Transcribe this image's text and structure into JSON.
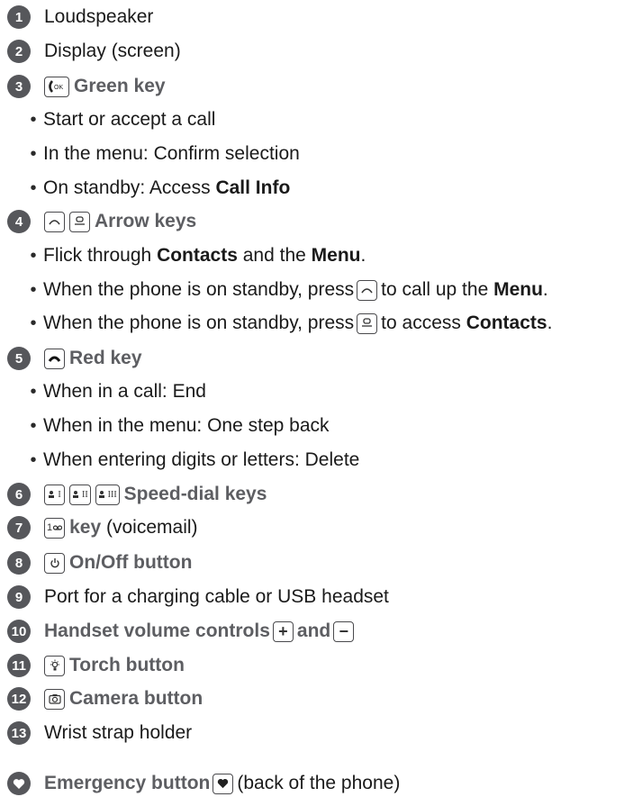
{
  "items": [
    {
      "num": "1",
      "label": "Loudspeaker"
    },
    {
      "num": "2",
      "label": "Display (screen)"
    },
    {
      "num": "3",
      "label": "Green key",
      "key_text": "OK",
      "bullets": [
        {
          "text": "Start or accept a call"
        },
        {
          "text": "In the menu: Confirm selection"
        },
        {
          "pre": "On standby: Access ",
          "bold": "Call Info"
        }
      ]
    },
    {
      "num": "4",
      "label": "Arrow keys",
      "bullets": [
        {
          "pre": "Flick through ",
          "bold1": "Contacts",
          "mid": " and the ",
          "bold2": "Menu",
          "post": "."
        },
        {
          "pre": "When the phone is on standby, press",
          "post": "to call up the ",
          "bold": "Menu",
          "end": "."
        },
        {
          "pre": "When the phone is on standby, press",
          "post": "to access ",
          "bold": "Contacts",
          "end": "."
        }
      ]
    },
    {
      "num": "5",
      "label": "Red key",
      "bullets": [
        {
          "text": "When in a call: End"
        },
        {
          "text": "When in the menu: One step back"
        },
        {
          "text": "When entering digits or letters: Delete"
        }
      ]
    },
    {
      "num": "6",
      "label": "Speed-dial keys",
      "keys": [
        "I",
        "II",
        "III"
      ]
    },
    {
      "num": "7",
      "key_text": "1",
      "label_bold": "key",
      "label_rest": " (voicemail)"
    },
    {
      "num": "8",
      "label": "On/Off button"
    },
    {
      "num": "9",
      "label": "Port for a charging cable or USB headset"
    },
    {
      "num": "10",
      "label": "Handset volume controls",
      "and_text": "and",
      "plus": "+",
      "minus": "−"
    },
    {
      "num": "11",
      "label": "Torch button"
    },
    {
      "num": "12",
      "label": "Camera button"
    },
    {
      "num": "13",
      "label": "Wrist strap holder"
    },
    {
      "label": "Emergency button",
      "suffix": "(back of the phone)"
    }
  ],
  "bullet_char": "•"
}
